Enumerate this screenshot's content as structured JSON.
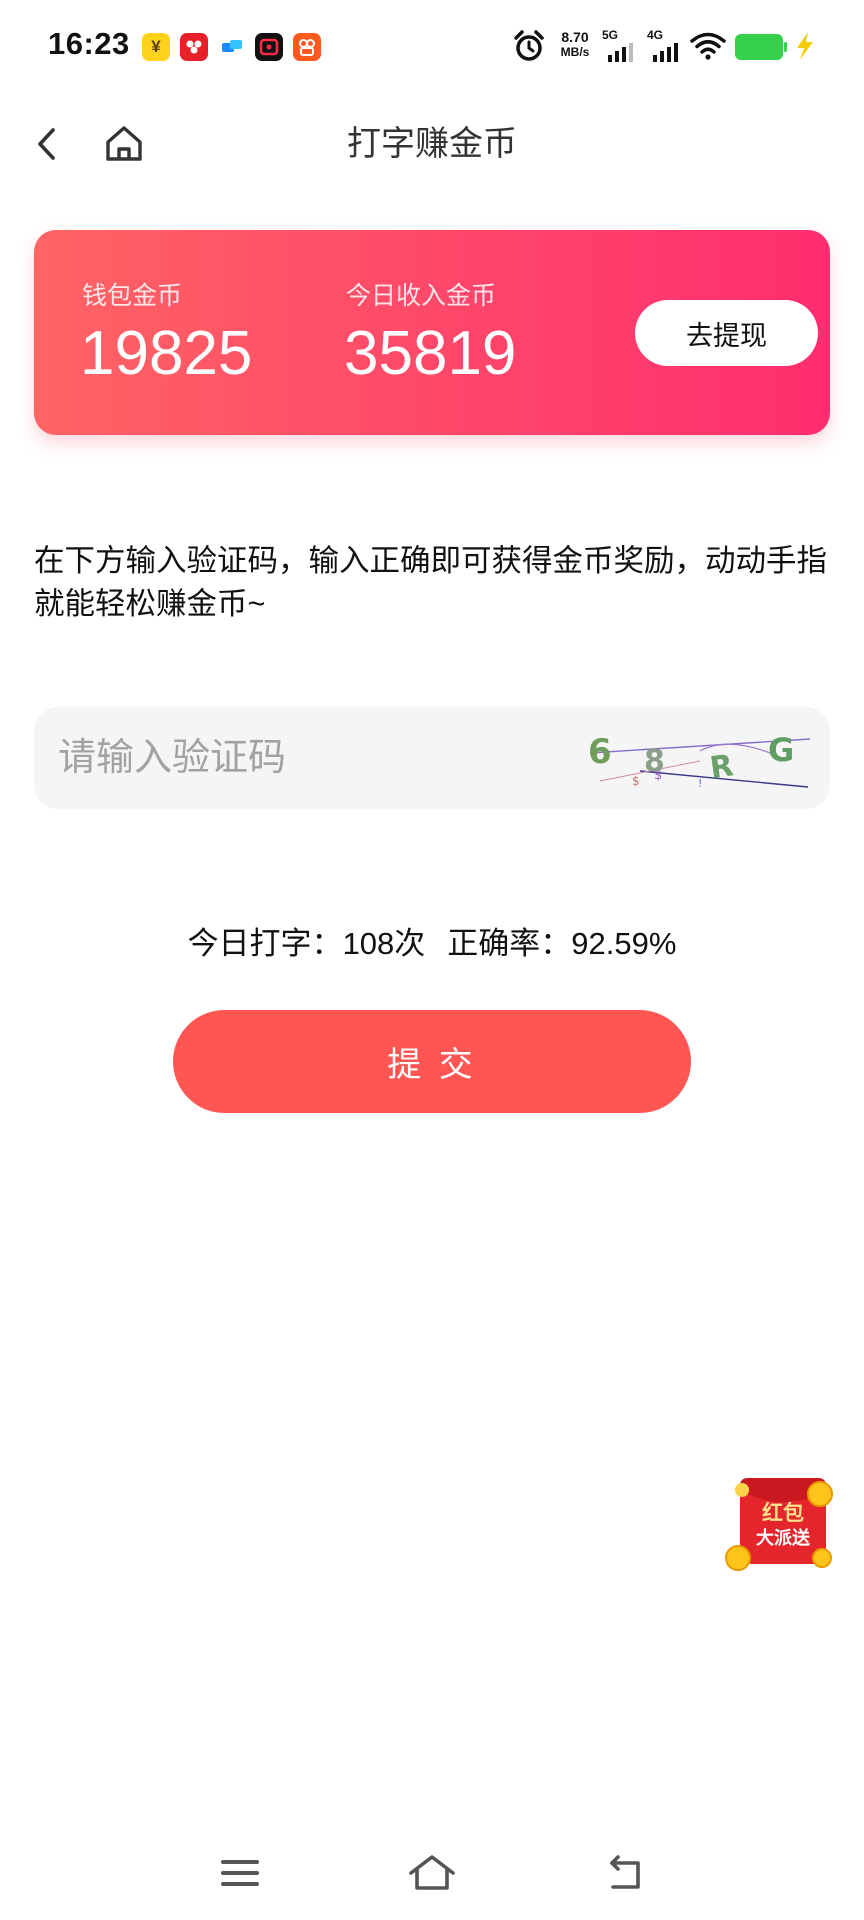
{
  "status_bar": {
    "time": "16:23",
    "wallet_app_glyph": "¥",
    "speed_value": "8.70",
    "speed_unit": "MB/s",
    "network_1": "5G",
    "network_2": "4G",
    "battery_color": "#35d14a",
    "charging_color": "#f2cf0a"
  },
  "header": {
    "title": "打字赚金币"
  },
  "wallet": {
    "coins_label": "钱包金币",
    "coins_value": "19825",
    "today_label": "今日收入金币",
    "today_value": "35819",
    "withdraw_label": "去提现",
    "gradient_start": "#ff6464",
    "gradient_end": "#ff2d6f"
  },
  "description": "在下方输入验证码，输入正确即可获得金币奖励，动动手指就能轻松赚金币~",
  "captcha_input": {
    "placeholder": "请输入验证码",
    "value": ""
  },
  "captcha_image": {
    "chars": [
      "6",
      "8",
      "R",
      "G"
    ]
  },
  "stats": {
    "typed_label": "今日打字：",
    "typed_value": "108次",
    "accuracy_label": "正确率：",
    "accuracy_value": "92.59%"
  },
  "submit_label": "提 交",
  "accent_color": "#ff5654",
  "red_packet": {
    "line1": "红包",
    "line2": "大派送"
  }
}
